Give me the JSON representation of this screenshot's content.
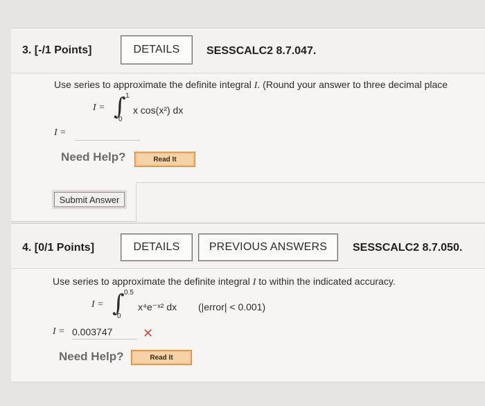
{
  "questions": [
    {
      "number_label": "3. [-/1 Points]",
      "details_label": "DETAILS",
      "code": "SESSCALC2 8.7.047.",
      "prompt_prefix": "Use series to approximate the definite integral ",
      "prompt_var": "I",
      "prompt_suffix": ". (Round your answer to three decimal place",
      "integral": {
        "lhs": "I =",
        "upper": "1",
        "lower": "0",
        "integrand": "x cos(x²) dx"
      },
      "answer_label": "I =",
      "answer_value": "",
      "need_help_label": "Need Help?",
      "read_it_label": "Read It",
      "submit_label": "Submit Answer"
    },
    {
      "number_label": "4. [0/1 Points]",
      "details_label": "DETAILS",
      "previous_answers_label": "PREVIOUS ANSWERS",
      "code": "SESSCALC2 8.7.050.",
      "prompt_prefix": "Use series to approximate the definite integral ",
      "prompt_var": "I",
      "prompt_suffix": " to within the indicated accuracy.",
      "integral": {
        "lhs": "I =",
        "upper": "0.5",
        "lower": "0",
        "integrand": "x⁴e⁻ˣ² dx",
        "accuracy": "(|error| < 0.001)"
      },
      "answer_label": "I =",
      "answer_value": "0.003747",
      "answer_status_icon": "x-icon",
      "need_help_label": "Need Help?",
      "read_it_label": "Read It"
    }
  ],
  "colors": {
    "read_it_bg": "#f6d3a7",
    "read_it_border": "#d4822c",
    "incorrect_mark": "#d94a3f"
  }
}
